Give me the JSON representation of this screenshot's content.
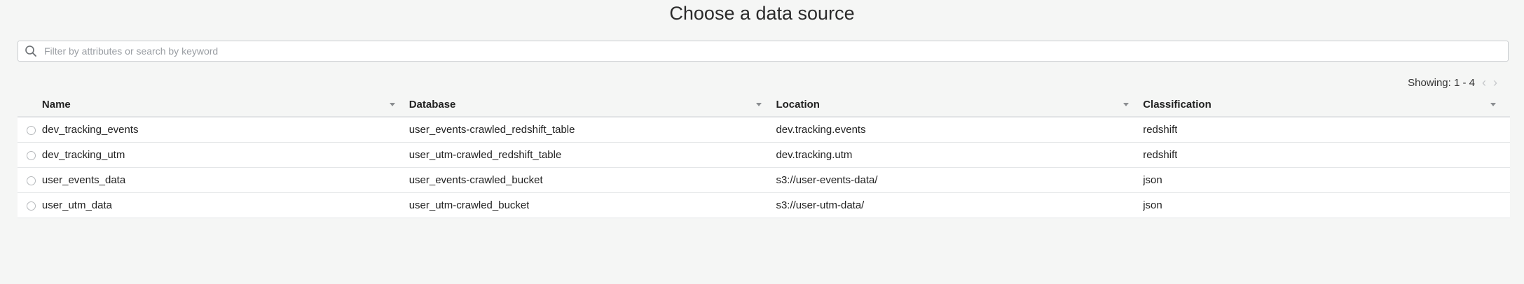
{
  "page": {
    "title": "Choose a data source"
  },
  "search": {
    "placeholder": "Filter by attributes or search by keyword",
    "value": ""
  },
  "pagination": {
    "showing": "Showing: 1 - 4"
  },
  "table": {
    "columns": [
      "Name",
      "Database",
      "Location",
      "Classification"
    ],
    "rows": [
      [
        "dev_tracking_events",
        "user_events-crawled_redshift_table",
        "dev.tracking.events",
        "redshift"
      ],
      [
        "dev_tracking_utm",
        "user_utm-crawled_redshift_table",
        "dev.tracking.utm",
        "redshift"
      ],
      [
        "user_events_data",
        "user_events-crawled_bucket",
        "s3://user-events-data/",
        "json"
      ],
      [
        "user_utm_data",
        "user_utm-crawled_bucket",
        "s3://user-utm-data/",
        "json"
      ]
    ]
  },
  "icons": {
    "search": "search-icon",
    "prev": "chevron-left-icon",
    "next": "chevron-right-icon",
    "sort": "caret-down-icon"
  }
}
